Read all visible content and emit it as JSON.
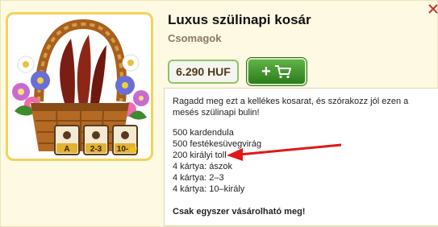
{
  "product": {
    "title": "Luxus szülinapi kosár",
    "category": "Csomagok",
    "price": "6.290 HUF"
  },
  "image": {
    "card_labels": [
      "A",
      "2-3",
      "10-"
    ]
  },
  "add_button": {
    "icons": [
      "plus-icon",
      "cart-icon"
    ]
  },
  "description": {
    "intro": "Ragadd meg ezt a kellékes kosarat, és szórakozz jól ezen a mesés szülinapi bulin!",
    "contents": [
      "500 kardendula",
      "500 festékesüvegvirág",
      "200 királyi toll",
      "4 kártya: ászok",
      "4 kártya: 2–3",
      "4 kártya: 10–király"
    ],
    "note": "Csak egyszer vásárolható meg!"
  },
  "colors": {
    "card_bg": "#fdf9e3",
    "frame_border": "#f1d35a",
    "button_green": "#3e9a2c",
    "arrow_red": "#e01818"
  }
}
